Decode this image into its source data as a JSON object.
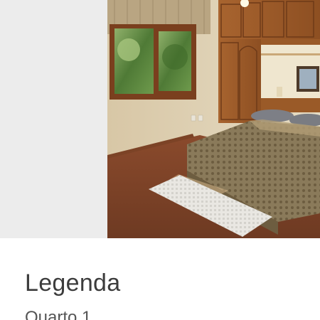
{
  "viewer": {
    "image_icon": "photo-image",
    "background_color": "#ececec"
  },
  "caption": {
    "heading": "Legenda",
    "text": "Quarto 1"
  }
}
